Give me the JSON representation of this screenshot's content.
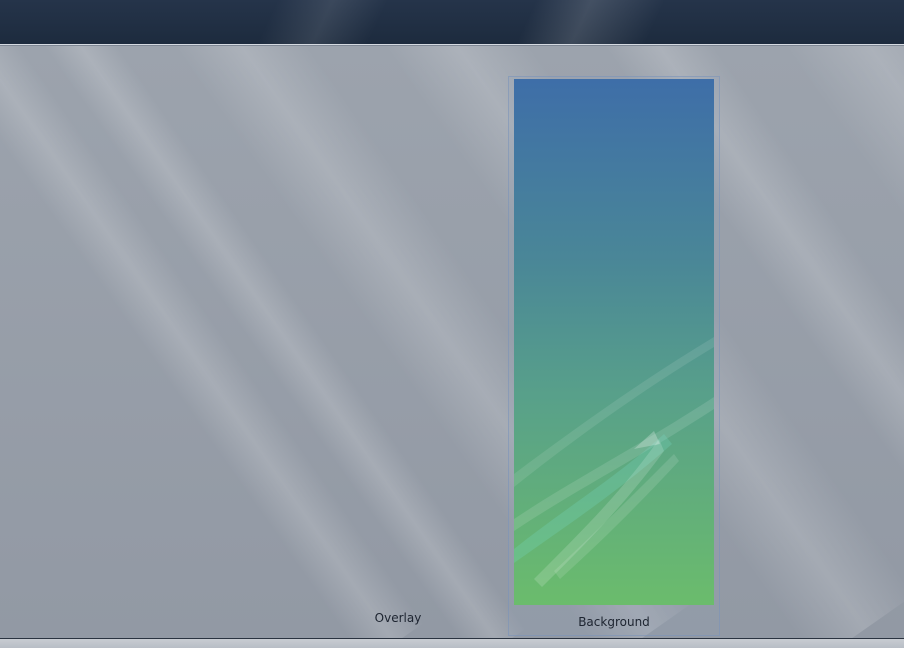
{
  "tiles": [
    {
      "id": "overlay",
      "label": "Overlay",
      "selected": false
    },
    {
      "id": "background",
      "label": "Background",
      "selected": true
    }
  ],
  "colors": {
    "title_bar": "#1d2b3e",
    "workspace": "#9299a4",
    "wallpaper_top": "#3e6ea8",
    "wallpaper_bottom": "#6bbc6c",
    "selection_border": "#7891b9"
  }
}
